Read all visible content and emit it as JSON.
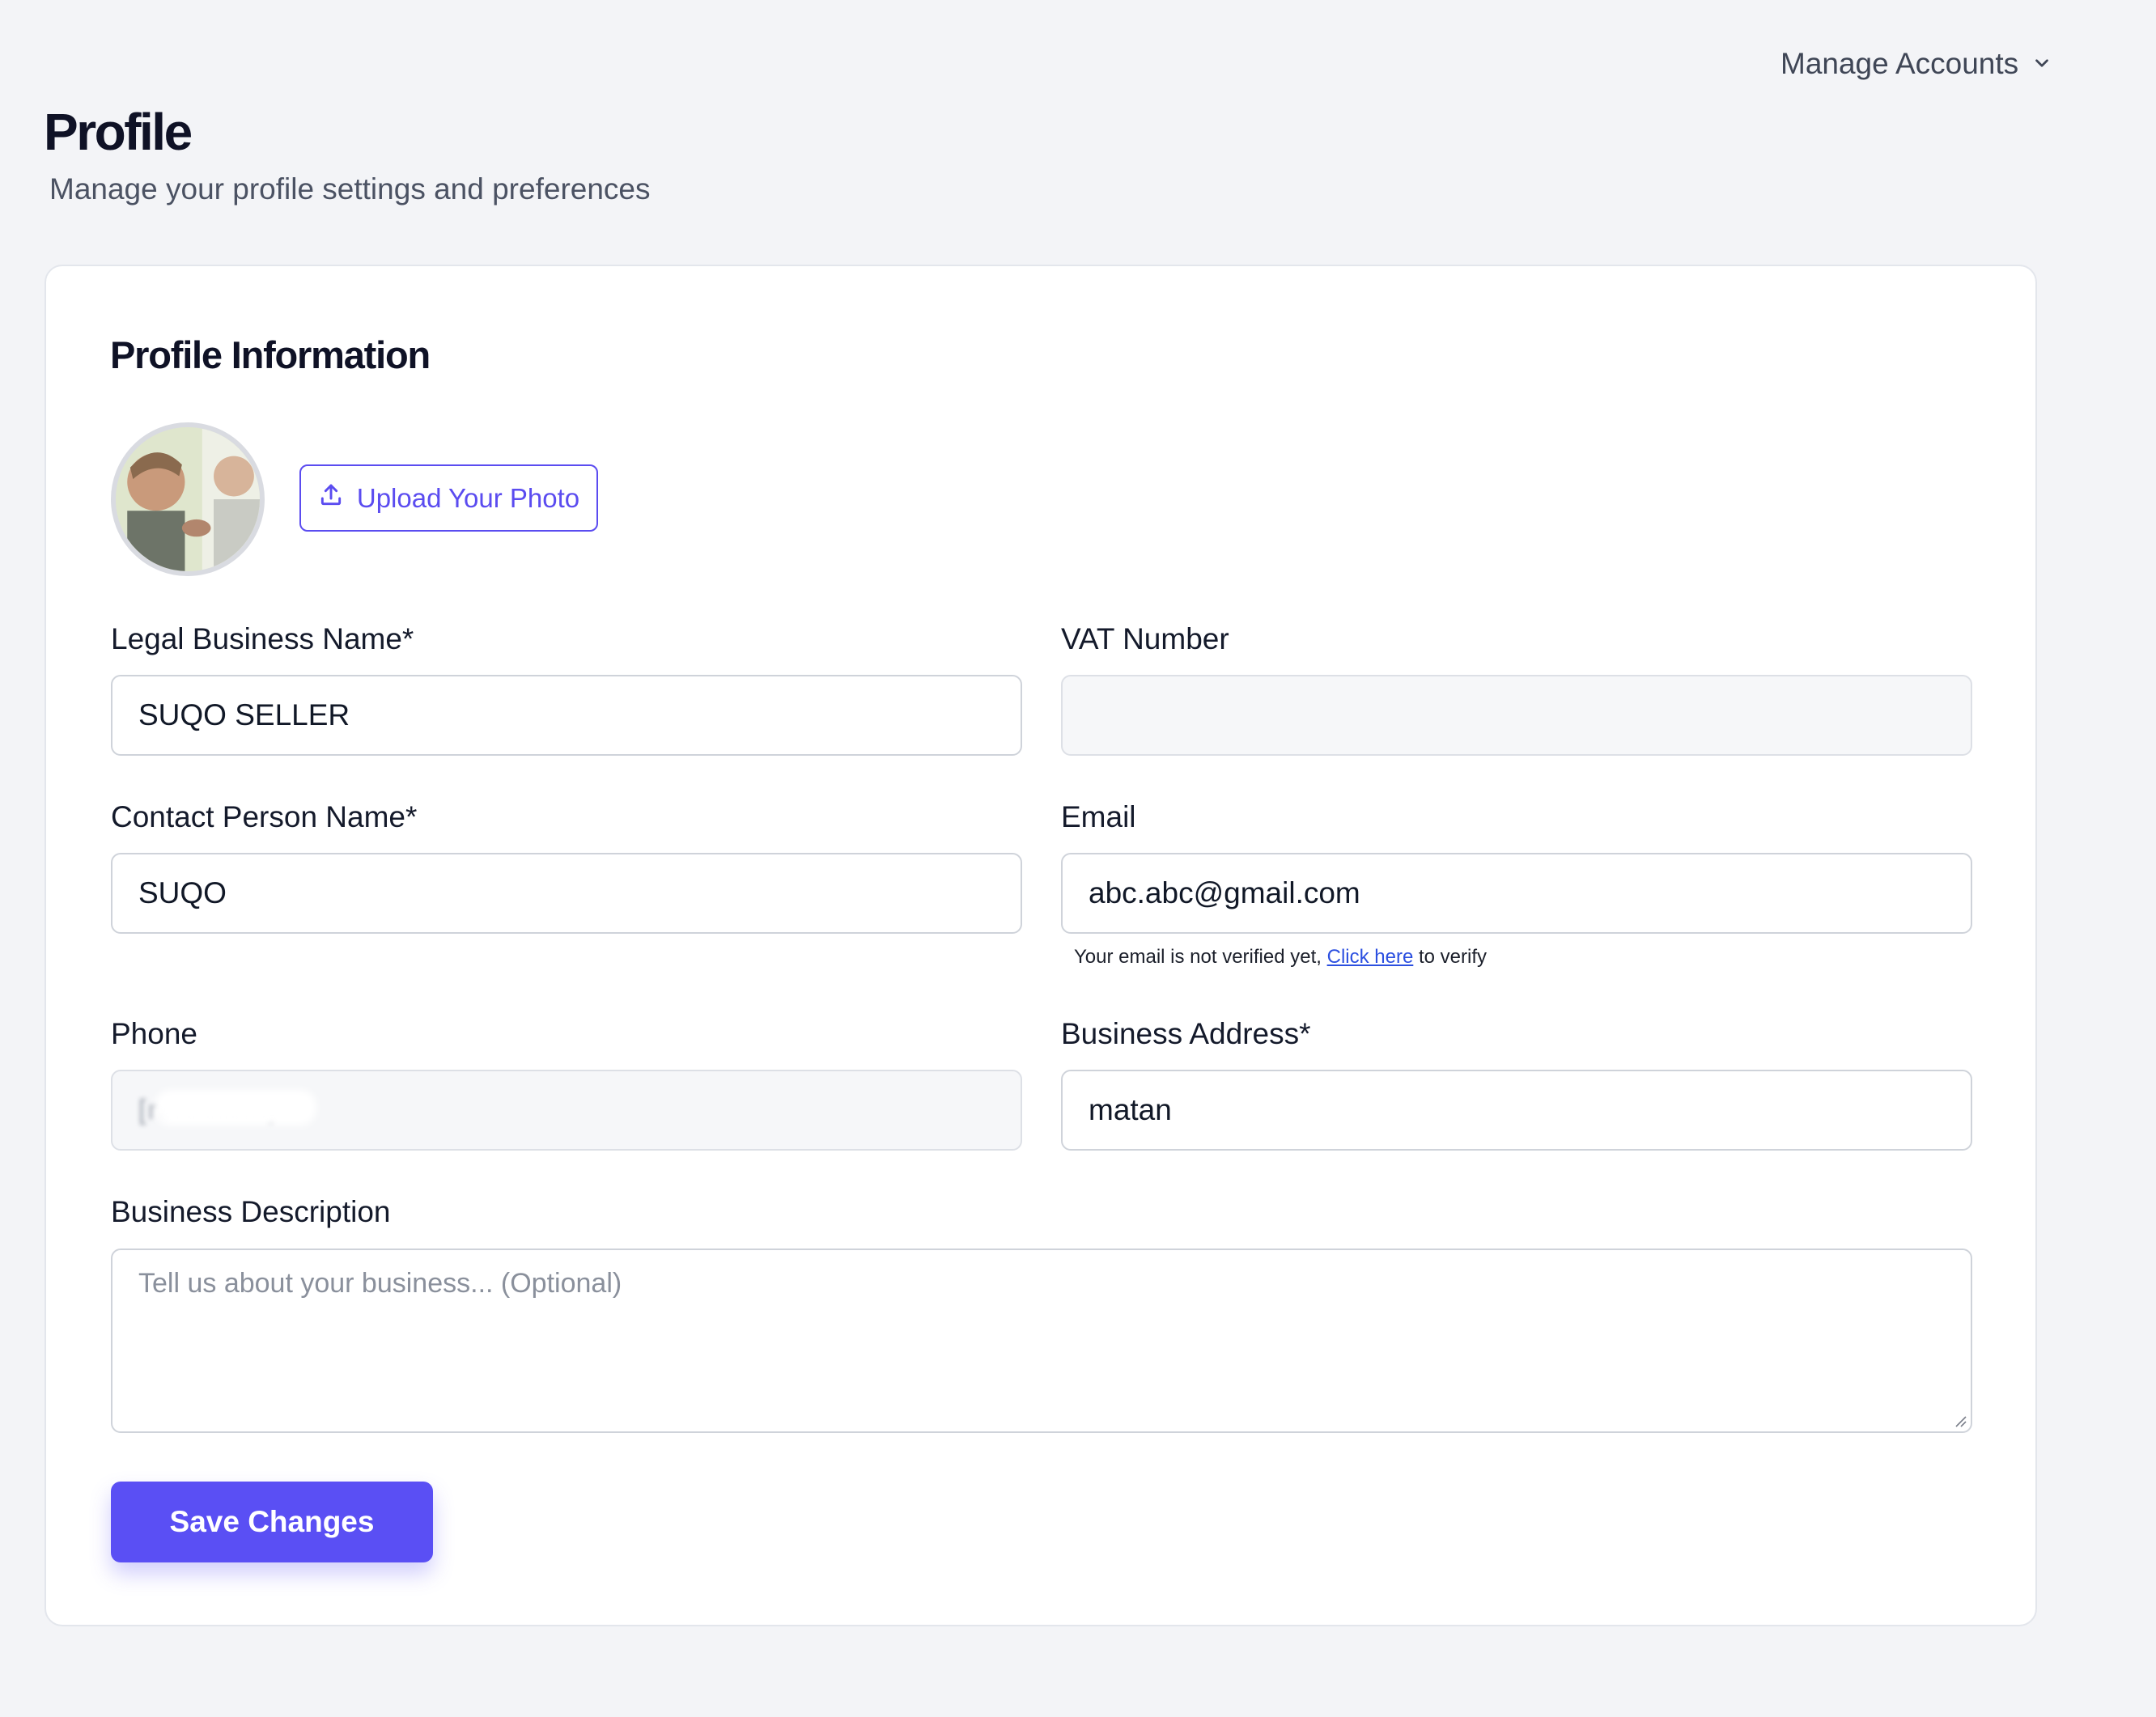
{
  "header": {
    "manage_accounts_label": "Manage Accounts",
    "page_title": "Profile",
    "page_subtitle": "Manage your profile settings and preferences"
  },
  "profile_card": {
    "title": "Profile Information",
    "upload_photo_label": "Upload Your Photo",
    "fields": {
      "legal_business_name": {
        "label": "Legal Business Name*",
        "value": "SUQO SELLER"
      },
      "vat_number": {
        "label": "VAT Number",
        "value": ""
      },
      "contact_person_name": {
        "label": "Contact Person Name*",
        "value": "SUQO"
      },
      "email": {
        "label": "Email",
        "value": "abc.abc@gmail.com"
      },
      "phone": {
        "label": "Phone",
        "value": "[redacted]"
      },
      "business_address": {
        "label": "Business Address*",
        "value": "matan"
      },
      "business_description": {
        "label": "Business Description",
        "placeholder": "Tell us about your business... (Optional)"
      }
    },
    "email_verify": {
      "prefix": "Your email is not verified yet,",
      "link_text": "Click here",
      "suffix": "to verify"
    },
    "save_label": "Save Changes"
  },
  "icons": {
    "manage_accounts": "chevron-down-icon",
    "upload": "upload-icon"
  },
  "colors": {
    "accent": "#5a4ff4",
    "background": "#f3f4f7",
    "link": "#2b4fe0"
  }
}
